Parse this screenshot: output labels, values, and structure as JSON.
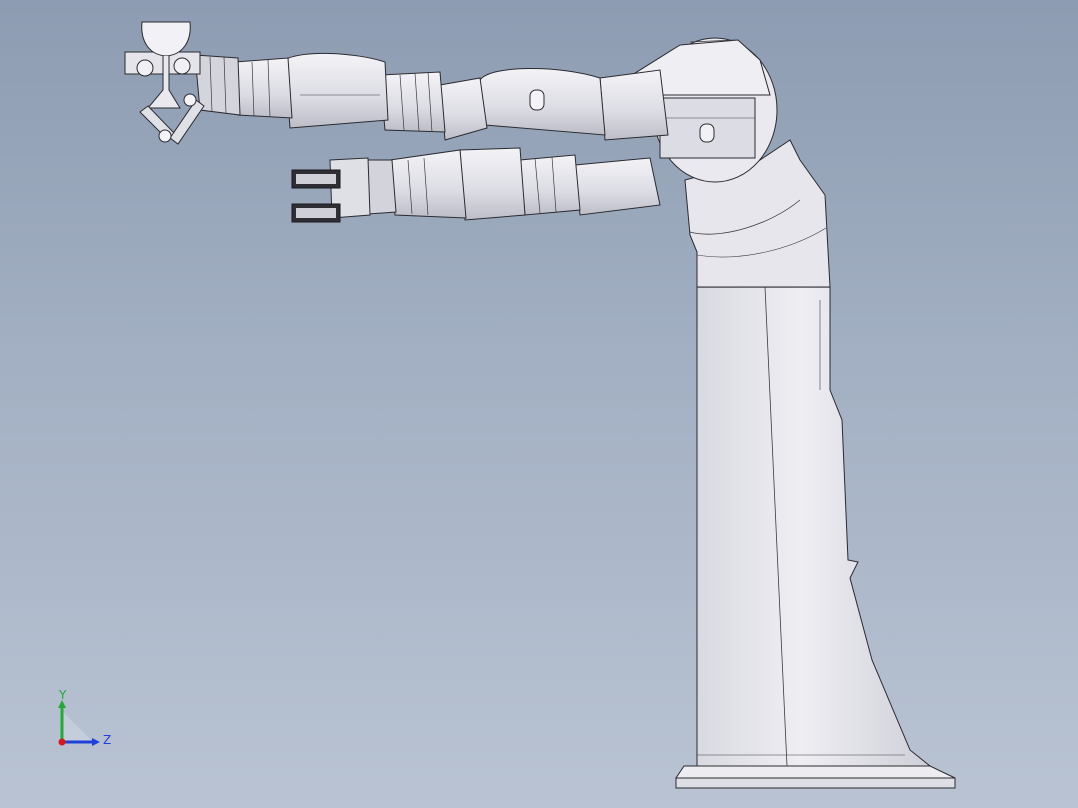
{
  "viewport": {
    "background_top": "#8d9cb2",
    "background_bottom": "#b9c3d3"
  },
  "model": {
    "icon": "dual-arm-robot-model",
    "body_color": "#e6e6ec",
    "edge_color": "#2a2a30",
    "shade_color": "#c9c9d2"
  },
  "triad": {
    "y_label": "Y",
    "z_label": "Z",
    "y_color": "#27a83a",
    "z_color": "#1f3fd6",
    "x_color": "#d11a1a"
  }
}
